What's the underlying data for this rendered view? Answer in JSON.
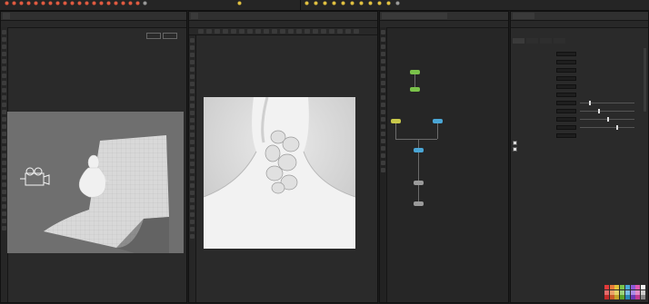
{
  "colors": {
    "accent_blue": "#4a90c8",
    "node_green": "#7ac24a",
    "node_yellow": "#c8c84a",
    "node_blue": "#4aa6d6",
    "node_gray": "#9a9a9a"
  },
  "shelf": {
    "tools": [
      {
        "icon": "box-icon",
        "color": "#e05a40"
      },
      {
        "icon": "sphere-icon",
        "color": "#e05a40"
      },
      {
        "icon": "tube-icon",
        "color": "#e05a40"
      },
      {
        "icon": "torus-icon",
        "color": "#e05a40"
      },
      {
        "icon": "grid-icon",
        "color": "#e05a40"
      },
      {
        "icon": "null-icon",
        "color": "#e05a40"
      },
      {
        "icon": "line-icon",
        "color": "#e05a40"
      },
      {
        "icon": "circle-icon",
        "color": "#e05a40"
      },
      {
        "icon": "curve-icon",
        "color": "#e05a40"
      },
      {
        "icon": "draw-curve-icon",
        "color": "#e05a40"
      },
      {
        "icon": "path-icon",
        "color": "#e05a40"
      },
      {
        "icon": "spray-paint-icon",
        "color": "#e05a40"
      },
      {
        "icon": "font-icon",
        "color": "#e05a40"
      },
      {
        "icon": "platonic-icon",
        "color": "#e05a40"
      },
      {
        "icon": "lsystem-icon",
        "color": "#e05a40"
      },
      {
        "icon": "metaball-icon",
        "color": "#e05a40"
      },
      {
        "icon": "file-icon",
        "color": "#e05a40"
      },
      {
        "icon": "spiral-icon",
        "color": "#e05a40"
      },
      {
        "icon": "helix-icon",
        "color": "#e05a40"
      },
      {
        "icon": "camera-icon",
        "color": "#999999"
      },
      {
        "icon": "point-light-icon",
        "color": "#e0c040"
      },
      {
        "icon": "spot-light-icon",
        "color": "#e0c040"
      },
      {
        "icon": "area-light-icon",
        "color": "#e0c040"
      },
      {
        "icon": "geometry-light-icon",
        "color": "#e0c040"
      },
      {
        "icon": "distant-light-icon",
        "color": "#e0c040"
      },
      {
        "icon": "environment-light-icon",
        "color": "#e0c040"
      },
      {
        "icon": "sky-light-icon",
        "color": "#e0c040"
      },
      {
        "icon": "gi-light-icon",
        "color": "#e0c040"
      },
      {
        "icon": "caustic-light-icon",
        "color": "#e0c040"
      },
      {
        "icon": "portal-light-icon",
        "color": "#e0c040"
      },
      {
        "icon": "ambient-light-icon",
        "color": "#e0c040"
      },
      {
        "icon": "stereo-camera-icon",
        "color": "#999999"
      }
    ]
  },
  "scene_view": {
    "tab_label": "",
    "path_label": "",
    "cam_label": "",
    "persp_label": ""
  },
  "render_view": {
    "tab_label": "",
    "path_label": ""
  },
  "network": {
    "tabs": [
      "",
      "",
      "",
      ""
    ],
    "path_label": "",
    "context_label": "",
    "nodes": [
      {
        "name": "",
        "color": "#7ac24a"
      },
      {
        "name": "",
        "color": "#7ac24a"
      },
      {
        "name": "",
        "color": "#c8c84a"
      },
      {
        "name": "",
        "color": "#4aa6d6"
      },
      {
        "name": "",
        "color": "#4aa6d6"
      },
      {
        "name": "",
        "color": "#9a9a9a"
      },
      {
        "name": "",
        "color": "#9a9a9a"
      }
    ]
  },
  "parameters": {
    "node_type": "",
    "node_name": "",
    "tabs": [
      "",
      "",
      "",
      ""
    ],
    "rows": [
      {
        "label": "",
        "value": ""
      },
      {
        "label": "",
        "value": ""
      },
      {
        "label": "",
        "value": ""
      },
      {
        "label": "",
        "value": ""
      },
      {
        "label": "",
        "value": ""
      },
      {
        "label": "",
        "value": ""
      },
      {
        "label": "",
        "value": ""
      },
      {
        "label": "",
        "value": ""
      },
      {
        "label": "",
        "value": ""
      },
      {
        "label": "",
        "value": ""
      },
      {
        "label": "",
        "value": ""
      }
    ],
    "toggles": [
      {
        "label": "",
        "checked": true
      },
      {
        "label": "",
        "checked": true
      }
    ],
    "swatches": [
      "#e23a3a",
      "#e87a3a",
      "#e2c23a",
      "#7ac24a",
      "#4aa6d6",
      "#8a5ad6",
      "#e25ab0",
      "#f2f2f2",
      "#e26a6a",
      "#e8a26a",
      "#e2d26a",
      "#9ad27a",
      "#7abce6",
      "#aa8ae6",
      "#e28ac6",
      "#cccccc",
      "#c22a2a",
      "#c85a2a",
      "#c2a22a",
      "#5aa22a",
      "#2a86b6",
      "#6a3ab6",
      "#c23a90",
      "#888888"
    ]
  }
}
